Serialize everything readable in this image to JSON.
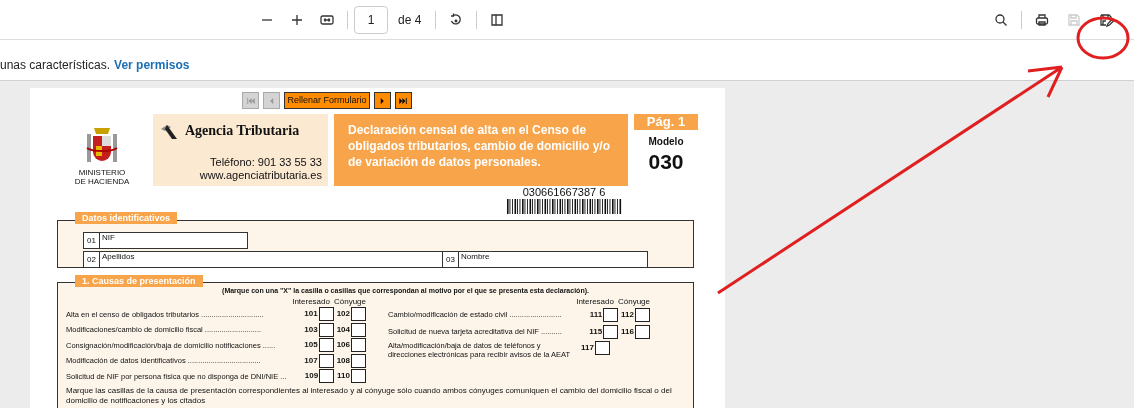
{
  "toolbar": {
    "page_input": "1",
    "page_count": "de 4",
    "save_disabled": true
  },
  "info_bar": {
    "text": "unas características.",
    "link": "Ver permisos"
  },
  "form": {
    "nav": [
      {
        "kind": "first",
        "disabled": true
      },
      {
        "kind": "prev",
        "disabled": true
      },
      {
        "kind": "label",
        "label": "Rellenar Formulario",
        "disabled": false
      },
      {
        "kind": "next",
        "disabled": false
      },
      {
        "kind": "last",
        "disabled": false
      }
    ],
    "ministry": [
      "MINISTERIO",
      "DE HACIENDA"
    ],
    "agency": {
      "name": "Agencia Tributaria",
      "phone": "Teléfono: 901 33 55 33",
      "web": "www.agenciatributaria.es"
    },
    "title": "Declaración censal de alta en el Censo de obligados tributarios, cambio de domicilio y/o de variación de datos personales.",
    "page_label": "Pág. 1",
    "model_label": "Modelo",
    "model_number": "030",
    "barcode_number": "030661667387 6",
    "identification": {
      "title": "Datos identificativos",
      "fields": [
        {
          "number": "01",
          "label": "NIF"
        },
        {
          "number": "02",
          "label": "Apellidos"
        },
        {
          "number": "03",
          "label": "Nombre"
        }
      ]
    },
    "causes": {
      "title": "1. Causas de presentación",
      "instruction": "(Marque con una \"X\" la casilla o casillas que correspondan al motivo por el que se presenta esta declaración).",
      "left_headers": [
        "Interesado",
        "Cónyuge"
      ],
      "right_headers": [
        "Interesado",
        "Cónyuge"
      ],
      "left_rows": [
        {
          "label": "Alta en el censo de obligados tributarios ..............................",
          "boxes": [
            {
              "number": "101",
              "checked": false
            },
            {
              "number": "102",
              "checked": false
            }
          ]
        },
        {
          "label": "Modificaciones/cambio de domicilio fiscal ...........................",
          "boxes": [
            {
              "number": "103",
              "checked": false
            },
            {
              "number": "104",
              "checked": false
            }
          ]
        },
        {
          "label": "Consignación/modificación/baja de domicilio notificaciones ......",
          "boxes": [
            {
              "number": "105",
              "checked": false
            },
            {
              "number": "106",
              "checked": false
            }
          ]
        },
        {
          "label": "Modificación de datos identificativos ...................................",
          "boxes": [
            {
              "number": "107",
              "checked": false
            },
            {
              "number": "108",
              "checked": false
            }
          ]
        },
        {
          "label": "Solicitud de NIF por persona física que no disponga de DNI/NIE ...",
          "boxes": [
            {
              "number": "109",
              "checked": false
            },
            {
              "number": "110",
              "checked": false
            }
          ]
        }
      ],
      "right_rows": [
        {
          "label": "Cambio/modificación de estado civil .........................",
          "boxes": [
            {
              "number": "111",
              "checked": false
            },
            {
              "number": "112",
              "checked": false
            }
          ]
        },
        {
          "label": "Solicitud de nueva tarjeta acreditativa del NIF ..........",
          "boxes": [
            {
              "number": "115",
              "checked": false
            },
            {
              "number": "116",
              "checked": false
            }
          ]
        },
        {
          "label": "Alta/modificación/baja de datos de teléfonos y direcciones electrónicas para recibir avisos de la AEAT",
          "boxes": [
            {
              "number": "117",
              "checked": false
            }
          ]
        }
      ],
      "note": "Marque las casillas de la causa de presentación correspondientes al interesado y al cónyuge sólo cuando ambos cónyuges comuniquen el cambio del domicilio fiscal o del domicilio de notificaciones y los citados"
    }
  }
}
